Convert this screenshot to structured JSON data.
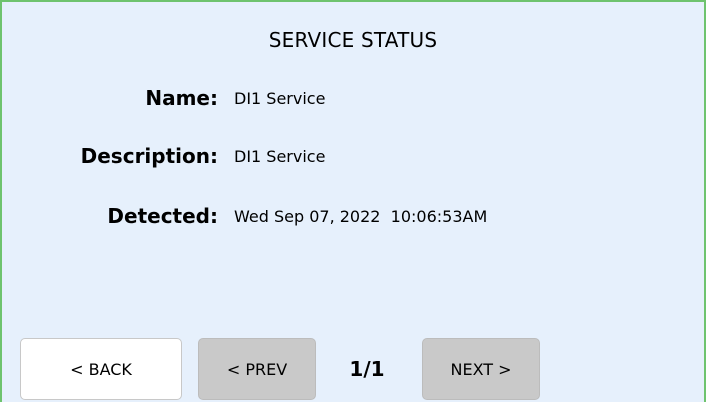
{
  "screen": {
    "title": "SERVICE STATUS"
  },
  "fields": {
    "name": {
      "label": "Name:",
      "value": "DI1 Service"
    },
    "description": {
      "label": "Description:",
      "value": "DI1 Service"
    },
    "detected": {
      "label": "Detected:",
      "value": "Wed Sep 07, 2022  10:06:53AM"
    }
  },
  "footer": {
    "back_label": "< BACK",
    "prev_label": "< PREV",
    "page_indicator": "1/1",
    "next_label": "NEXT >"
  },
  "colors": {
    "background": "#e6f0fc",
    "border": "#6ec36e",
    "button_active": "#ffffff",
    "button_disabled": "#c9c9c9"
  }
}
